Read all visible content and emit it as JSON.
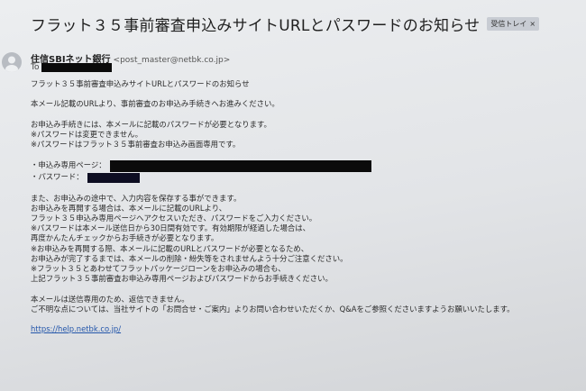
{
  "email": {
    "subject": "フラット３５事前審査申込みサイトURLとパスワードのお知らせ",
    "badge_label": "受信トレイ",
    "badge_close": "×",
    "from_name": "住信SBIネット銀行",
    "from_email": "<post_master@netbk.co.jp>",
    "to_label": "To",
    "body": {
      "line1": "フラット３５事前審査申込みサイトURLとパスワードのお知らせ",
      "line2": "本メール記載のURLより、事前審査のお申込み手続きへお進みください。",
      "line3": "お申込み手続きには、本メールに記載のパスワードが必要となります。",
      "line4": "※パスワードは変更できません。",
      "line5": "※パスワードはフラット３５事前審査お申込み画面専用です。",
      "url_label": "・申込み専用ページ：",
      "password_label": "・パスワード：",
      "line6": "また、お申込みの途中で、入力内容を保存する事ができます。",
      "line7": "お申込みを再開する場合は、本メールに記載のURLより、",
      "line8": "フラット３５申込み専用ページへアクセスいただき、パスワードをご入力ください。",
      "line9": "※パスワードは本メール送信日から30日間有効です。有効期限が経過した場合は、",
      "line10": "再度かんたんチェックからお手続きが必要となります。",
      "line11": "※お申込みを再開する際、本メールに記載のURLとパスワードが必要となるため、",
      "line12": "お申込みが完了するまでは、本メールの削除・紛失等をされませんよう十分ご注意ください。",
      "line13": "※フラット３５とあわせてフラットパッケージローンをお申込みの場合も、",
      "line14": "上記フラット３５事前審査お申込み専用ページおよびパスワードからお手続きください。",
      "line15": "本メールは送信専用のため、返信できません。",
      "line16": "ご不明な点については、当社サイトの「お問合せ・ご案内」よりお問い合わせいただくか、Q&Aをご参照くださいますようお願いいたします。",
      "footer_link": "https://help.netbk.co.jp/"
    }
  }
}
